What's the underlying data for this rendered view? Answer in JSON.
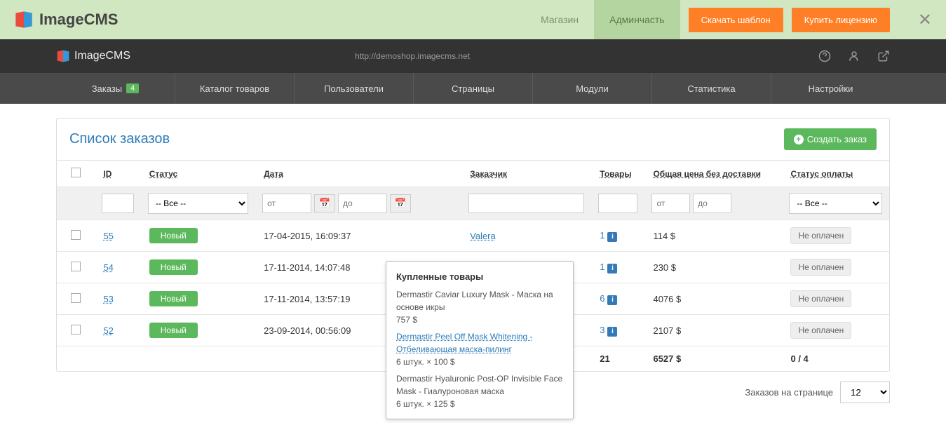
{
  "topbar": {
    "logo": "ImageCMS",
    "nav_shop": "Магазин",
    "nav_admin": "Админчасть",
    "btn_download": "Скачать шаблон",
    "btn_buy": "Купить лицензию"
  },
  "darkbar": {
    "logo": "ImageCMS",
    "demo_url": "http://demoshop.imagecms.net"
  },
  "menu": {
    "orders": "Заказы",
    "orders_badge": "4",
    "catalog": "Каталог товаров",
    "users": "Пользователи",
    "pages": "Страницы",
    "modules": "Модули",
    "stats": "Статистика",
    "settings": "Настройки"
  },
  "panel": {
    "title": "Список заказов",
    "create_btn": "Создать заказ"
  },
  "headers": {
    "id": "ID",
    "status": "Статус",
    "date": "Дата",
    "customer": "Заказчик",
    "goods": "Товары",
    "total": "Общая цена без доставки",
    "pay": "Статус оплаты"
  },
  "filters": {
    "status_all": "-- Все --",
    "pay_all": "-- Все --",
    "date_from": "от",
    "date_to": "до",
    "price_from": "от",
    "price_to": "до"
  },
  "rows": [
    {
      "id": "55",
      "status": "Новый",
      "date": "17-04-2015, 16:09:37",
      "customer": "Valera",
      "goods": "1",
      "price": "114 $",
      "pay": "Не оплачен"
    },
    {
      "id": "54",
      "status": "Новый",
      "date": "17-11-2014, 14:07:48",
      "customer": "",
      "goods": "1",
      "price": "230 $",
      "pay": "Не оплачен"
    },
    {
      "id": "53",
      "status": "Новый",
      "date": "17-11-2014, 13:57:19",
      "customer": "",
      "goods": "6",
      "price": "4076 $",
      "pay": "Не оплачен"
    },
    {
      "id": "52",
      "status": "Новый",
      "date": "23-09-2014, 00:56:09",
      "customer": "",
      "goods": "3",
      "price": "2107 $",
      "pay": "Не оплачен"
    }
  ],
  "totals": {
    "goods": "21",
    "price": "6527 $",
    "pay": "0 / 4"
  },
  "tooltip": {
    "title": "Купленные товары",
    "item1_name": "Dermastir Caviar Luxury Mask - Маска на основе икры",
    "item1_price": "757 $",
    "item2_link": "Dermastir Peel Off Mask Whitening - Отбеливающая маска-пилинг",
    "item2_qty": "6 штук. × 100 $",
    "item3_name": "Dermastir Hyaluronic Post-OP Invisible Face Mask - Гиалуроновая маска",
    "item3_qty": "6 штук. × 125 $"
  },
  "pager": {
    "label": "Заказов на странице",
    "value": "12"
  }
}
